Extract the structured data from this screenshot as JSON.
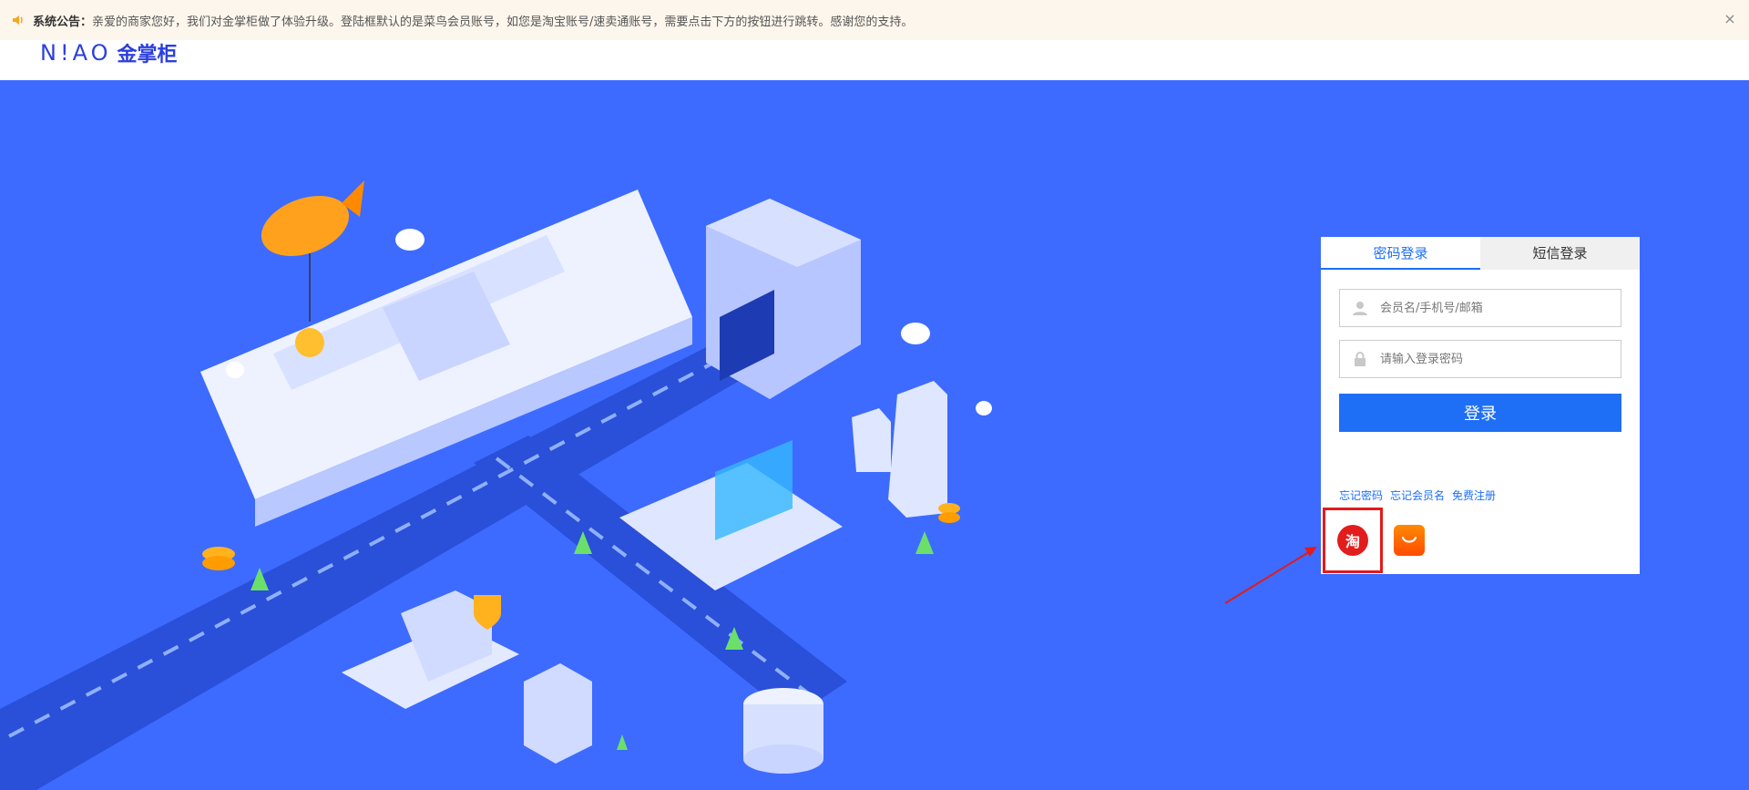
{
  "notice": {
    "title": "系统公告：",
    "text": "亲爱的商家您好，我们对金掌柜做了体验升级。登陆框默认的是菜鸟会员账号，如您是淘宝账号/速卖通账号，需要点击下方的按钮进行跳转。感谢您的支持。",
    "close": "×"
  },
  "logo": {
    "en": "N!AO",
    "cn": "金掌柜"
  },
  "login": {
    "tabs": [
      {
        "label": "密码登录",
        "active": true
      },
      {
        "label": "短信登录",
        "active": false
      }
    ],
    "username_placeholder": "会员名/手机号/邮箱",
    "password_placeholder": "请输入登录密码",
    "submit_label": "登录",
    "links": {
      "forgot_password": "忘记密码",
      "forgot_username": "忘记会员名",
      "register": "免费注册"
    },
    "third_party": {
      "taobao_glyph": "淘"
    }
  },
  "colors": {
    "accent": "#1e6ff5",
    "hero_bg": "#3d6bff",
    "highlight": "#e21b1b",
    "brand": "#2c3fdc"
  }
}
